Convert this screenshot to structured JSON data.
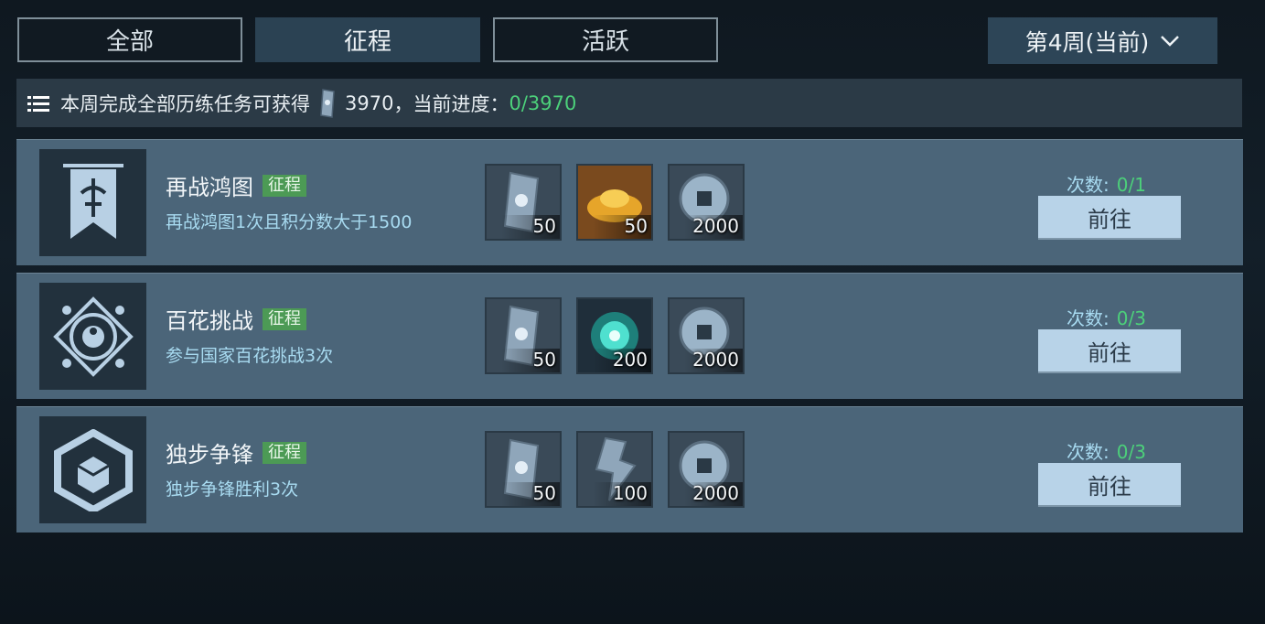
{
  "tabs": [
    {
      "label": "全部",
      "active": false
    },
    {
      "label": "征程",
      "active": true
    },
    {
      "label": "活跃",
      "active": false
    }
  ],
  "week_selector": {
    "label": "第4周(当前)"
  },
  "banner": {
    "text": "本周完成全部历练任务可获得",
    "reward_amount": "3970",
    "progress_label": "，当前进度：",
    "progress_value": "0/3970"
  },
  "tasks": [
    {
      "icon": "banner-icon",
      "title": "再战鸿图",
      "tag": "征程",
      "desc": "再战鸿图1次且积分数大于1500",
      "rewards": [
        {
          "icon": "scroll-token-icon",
          "amount": "50"
        },
        {
          "icon": "gold-ingot-icon",
          "amount": "50"
        },
        {
          "icon": "coin-icon",
          "amount": "2000"
        }
      ],
      "count_label": "次数:",
      "count_value": "0/1",
      "button": "前往"
    },
    {
      "icon": "taiji-emblem-icon",
      "title": "百花挑战",
      "tag": "征程",
      "desc": "参与国家百花挑战3次",
      "rewards": [
        {
          "icon": "scroll-token-icon",
          "amount": "50"
        },
        {
          "icon": "spirit-orb-icon",
          "amount": "200"
        },
        {
          "icon": "coin-icon",
          "amount": "2000"
        }
      ],
      "count_label": "次数:",
      "count_value": "0/3",
      "button": "前往"
    },
    {
      "icon": "hex-cube-icon",
      "title": "独步争锋",
      "tag": "征程",
      "desc": "独步争锋胜利3次",
      "rewards": [
        {
          "icon": "scroll-token-icon",
          "amount": "50"
        },
        {
          "icon": "shard-icon",
          "amount": "100"
        },
        {
          "icon": "coin-icon",
          "amount": "2000"
        }
      ],
      "count_label": "次数:",
      "count_value": "0/3",
      "button": "前往"
    }
  ],
  "colors": {
    "progress": "#4cd07a",
    "tag": "#4c9a55",
    "button": "#b8d3e8"
  }
}
